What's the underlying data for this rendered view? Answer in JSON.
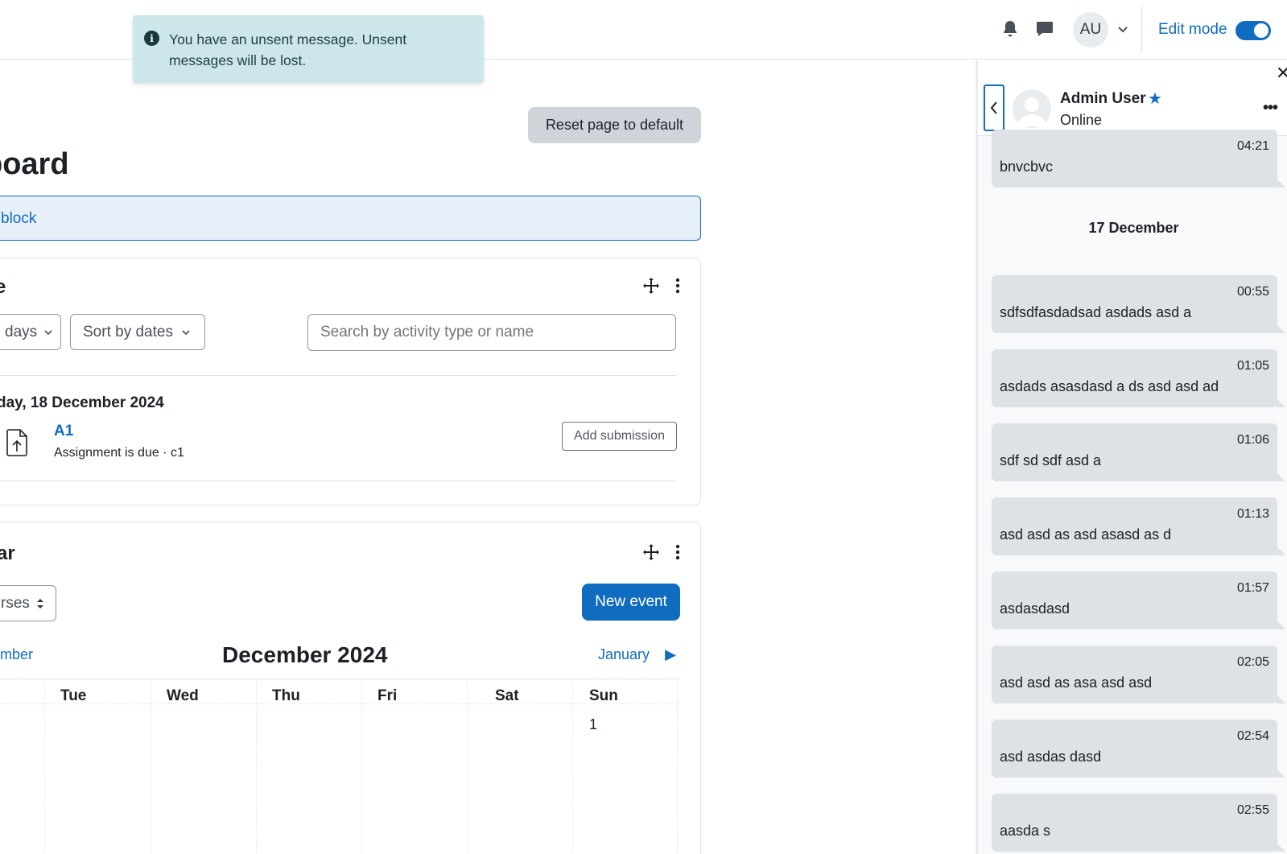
{
  "navbar": {
    "avatar_initials": "AU",
    "edit_mode_label": "Edit mode",
    "edit_mode_on": true
  },
  "toast": {
    "message": "You have an unsent message. Unsent messages will be lost."
  },
  "main": {
    "reset_label": "Reset page to default",
    "page_title": "board",
    "add_block_label": "block",
    "timeline": {
      "title": "e",
      "filter_days": "days",
      "sort_label": "Sort by dates",
      "search_placeholder": "Search by activity type or name",
      "date_heading": "day, 18 December 2024",
      "activity": {
        "name": "A1",
        "meta": "Assignment is due · c1",
        "action_label": "Add submission"
      }
    },
    "calendar": {
      "title": "ar",
      "course_select": "rses",
      "new_event_label": "New event",
      "month_title": "December 2024",
      "prev_month": "mber",
      "next_month": "January",
      "day_headers": [
        "Tue",
        "Wed",
        "Thu",
        "Fri",
        "Sat",
        "Sun"
      ],
      "first_day": "1"
    }
  },
  "drawer": {
    "user_name": "Admin User",
    "status": "Online",
    "first_message": {
      "time": "04:21",
      "text": "bnvcbvc"
    },
    "day_separator": "17 December",
    "messages": [
      {
        "time": "00:55",
        "text": "sdfsdfasdadsad asdads asd a"
      },
      {
        "time": "01:05",
        "text": "asdads asasdasd a ds asd asd ad"
      },
      {
        "time": "01:06",
        "text": "sdf sd sdf asd a"
      },
      {
        "time": "01:13",
        "text": "asd asd as asd asasd as d"
      },
      {
        "time": "01:57",
        "text": "asdasdasd"
      },
      {
        "time": "02:05",
        "text": "asd asd as asa asd asd"
      },
      {
        "time": "02:54",
        "text": "asd asdas dasd"
      },
      {
        "time": "02:55",
        "text": "aasda s"
      }
    ]
  },
  "colors": {
    "primary": "#0f6cbf",
    "toast_bg": "#cce6ea",
    "message_bg": "#dee2e6"
  }
}
